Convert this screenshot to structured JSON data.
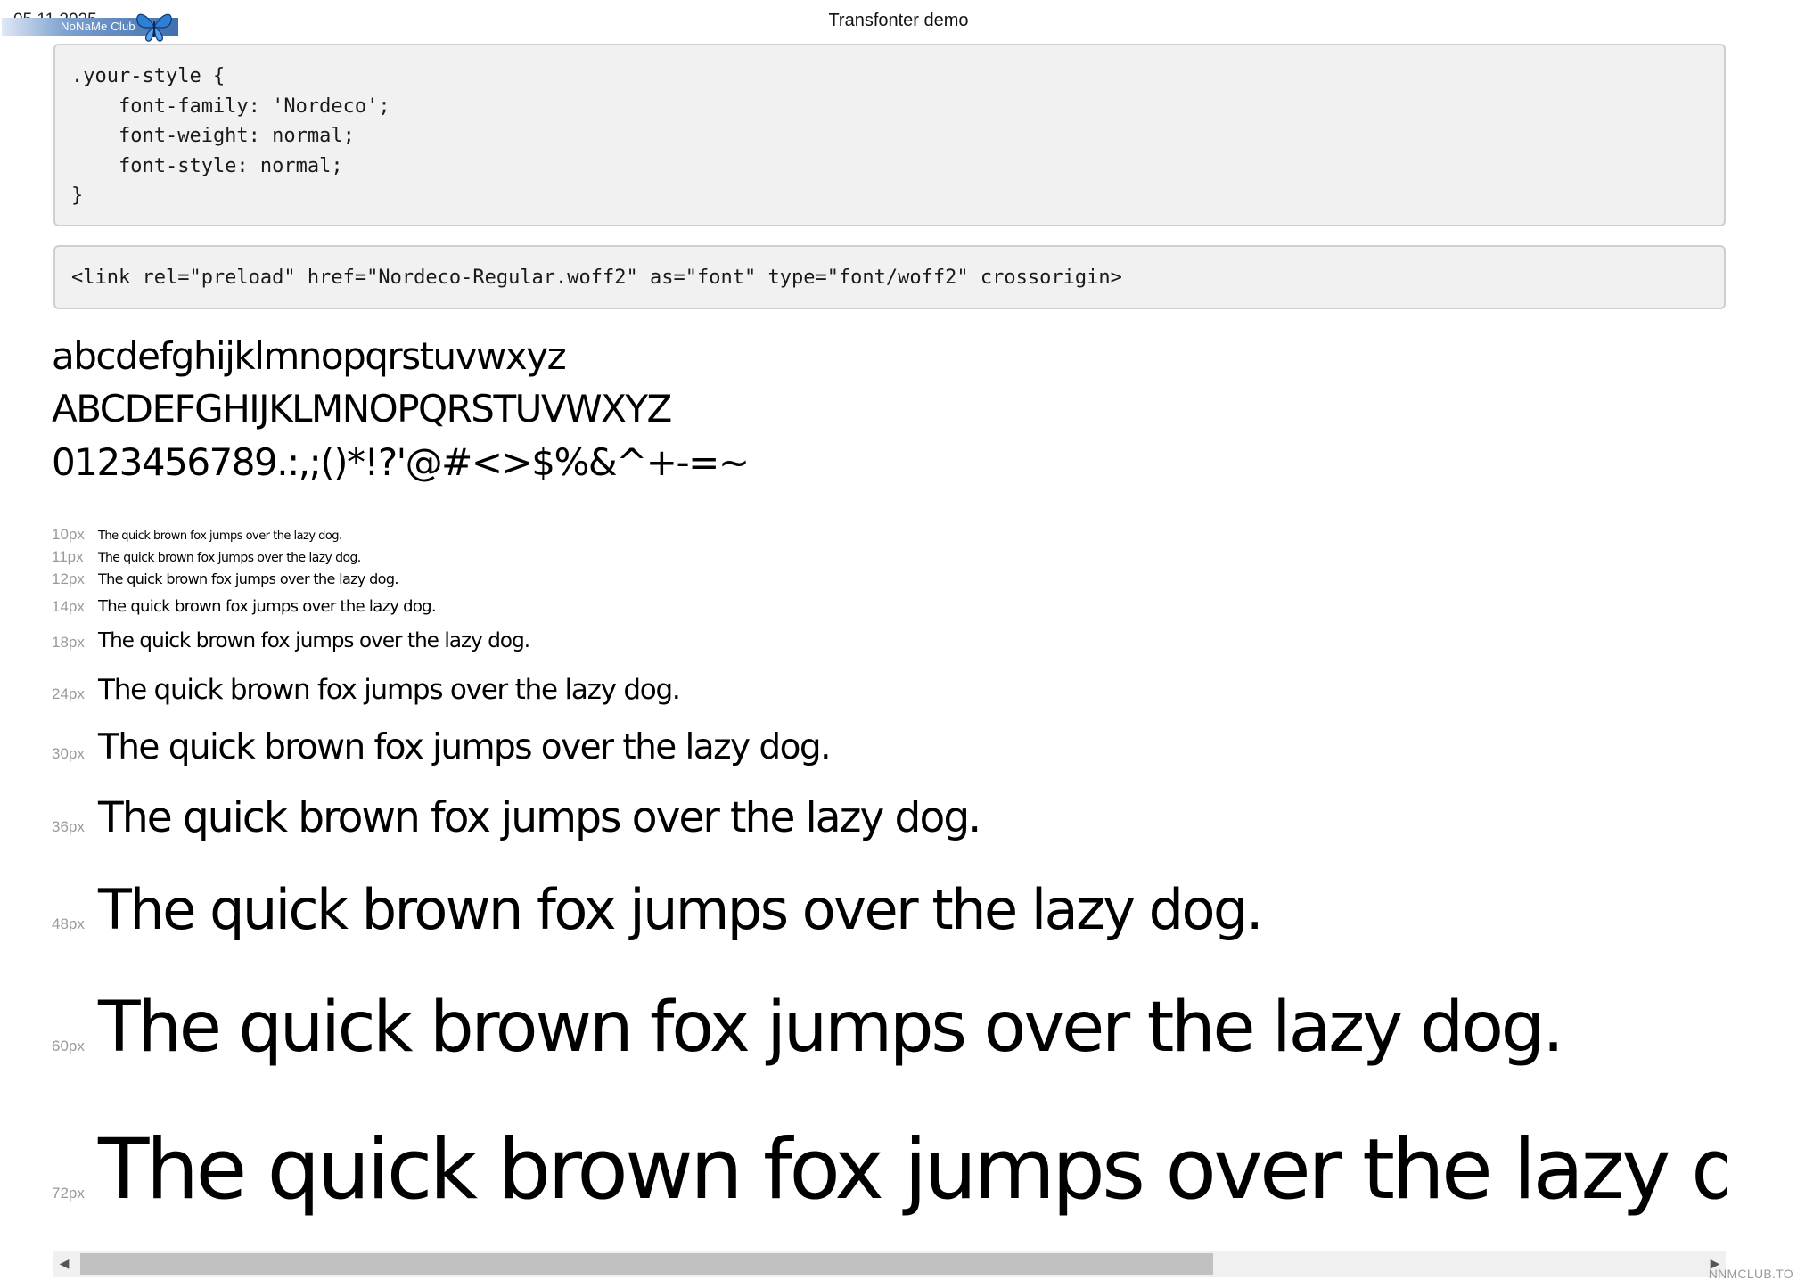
{
  "header": {
    "date": "05.11.2025",
    "title": "Transfonter demo",
    "watermark_badge": "NoNaMe Club"
  },
  "code": {
    "css_block": ".your-style {\n    font-family: 'Nordeco';\n    font-weight: normal;\n    font-style: normal;\n}",
    "link_block": "<link rel=\"preload\" href=\"Nordeco-Regular.woff2\" as=\"font\" type=\"font/woff2\" crossorigin>"
  },
  "glyphs": {
    "lowercase": "abcdefghijklmnopqrstuvwxyz",
    "uppercase": "ABCDEFGHIJKLMNOPQRSTUVWXYZ",
    "symbols": "0123456789.:,;()*!?'@#<>$%&^+-=~"
  },
  "sample_text": "The quick brown fox jumps over the lazy dog.",
  "samples": [
    {
      "label": "10px",
      "size": 10
    },
    {
      "label": "11px",
      "size": 11
    },
    {
      "label": "12px",
      "size": 12
    },
    {
      "label": "14px",
      "size": 14
    },
    {
      "label": "18px",
      "size": 18
    },
    {
      "label": "24px",
      "size": 24
    },
    {
      "label": "30px",
      "size": 30
    },
    {
      "label": "36px",
      "size": 36
    },
    {
      "label": "48px",
      "size": 48
    },
    {
      "label": "60px",
      "size": 60
    },
    {
      "label": "72px",
      "size": 72
    }
  ],
  "scrollbar": {
    "thumb_fraction": 0.7
  },
  "footer": {
    "watermark": "NNMCLUB.TO"
  },
  "colors": {
    "code_background": "#f1f1f1",
    "code_border": "#cfcfcf",
    "size_label": "#9a9a9a",
    "scroll_thumb": "#c1c1c1"
  }
}
